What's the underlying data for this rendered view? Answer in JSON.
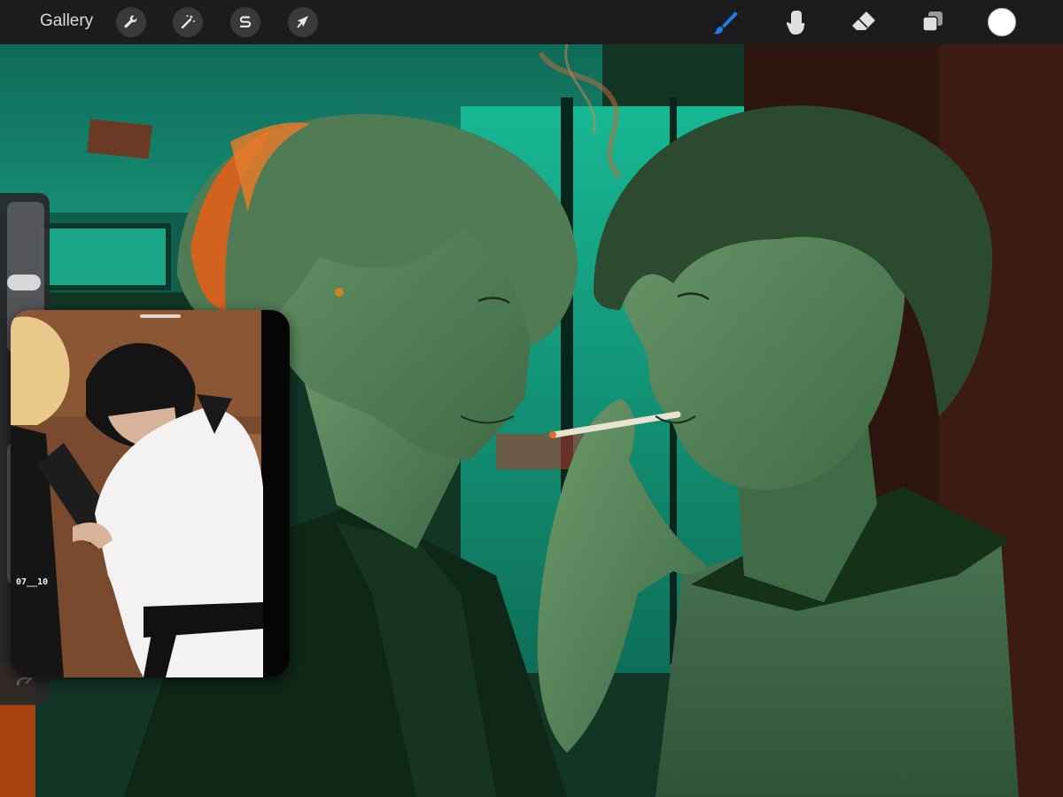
{
  "toolbar": {
    "gallery_label": "Gallery",
    "left_tools": [
      {
        "name": "actions",
        "icon": "wrench-icon"
      },
      {
        "name": "adjustments",
        "icon": "magic-wand-icon"
      },
      {
        "name": "selection",
        "icon": "selection-s-icon"
      },
      {
        "name": "transform",
        "icon": "cursor-arrow-icon"
      }
    ],
    "right_tools": [
      {
        "name": "brush",
        "icon": "brush-icon",
        "active": true
      },
      {
        "name": "smudge",
        "icon": "smudge-finger-icon",
        "active": false
      },
      {
        "name": "eraser",
        "icon": "eraser-icon",
        "active": false
      },
      {
        "name": "layers",
        "icon": "layers-icon",
        "active": false
      }
    ],
    "current_color": "#ffffff",
    "active_tool_color": "#1e7bf0"
  },
  "reference": {
    "timestamp": "07__10"
  },
  "colors": {
    "toolbar_bg": "#1c1c1e",
    "scene_teal": "#18b894",
    "skin_green": "#5f8f62",
    "cigarette_ember": "#e66a2a"
  }
}
